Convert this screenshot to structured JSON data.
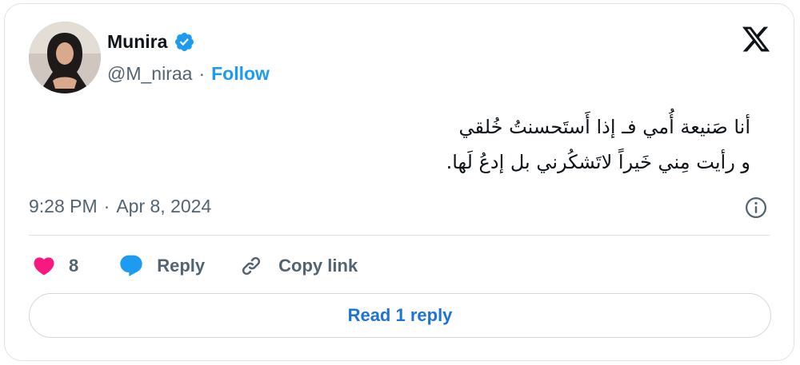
{
  "author": {
    "display_name": "Munira",
    "handle": "@M_niraa",
    "follow_label": "Follow",
    "verified_icon": "verified-badge-icon",
    "verified_color": "#1d9bf0"
  },
  "platform_icon": "x-logo-icon",
  "tweet": {
    "lines": [
      "أنا صَنيعة أُمي فـ إذا أَستَحسنتُ خُلقي",
      "و رأيت مِني خَيراً لاتَشكُرني بل إدعُ لَها."
    ],
    "time": "9:28 PM",
    "date": "Apr 8, 2024"
  },
  "actions": {
    "like_count": "8",
    "reply_label": "Reply",
    "copy_link_label": "Copy link"
  },
  "read_replies_label": "Read 1 reply",
  "colors": {
    "accent": "#1d9bf0",
    "like": "#f91880",
    "muted_text": "#536471",
    "border": "#dfe3e7"
  }
}
